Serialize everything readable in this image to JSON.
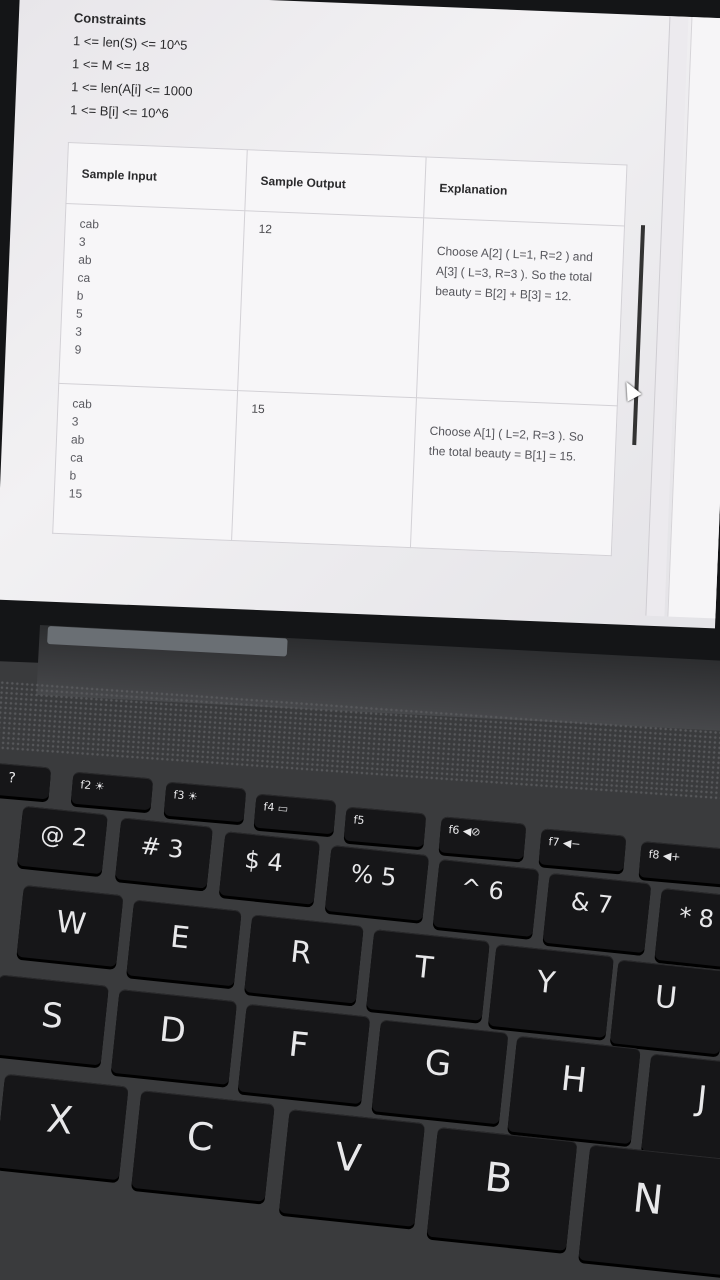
{
  "constraints": {
    "heading": "Constraints",
    "lines": [
      "1 <= len(S) <= 10^5",
      "1 <= M <= 18",
      "1 <= len(A[i] <= 1000",
      "1 <= B[i] <= 10^6"
    ]
  },
  "table": {
    "headers": [
      "Sample Input",
      "Sample Output",
      "Explanation"
    ],
    "rows": [
      {
        "input": [
          "cab",
          "3",
          "ab",
          "ca",
          "b",
          "5",
          "3",
          "9"
        ],
        "output": "12",
        "explanation": "Choose A[2] ( L=1, R=2 ) and A[3] ( L=3, R=3 ). So the total beauty = B[2] + B[3] = 12."
      },
      {
        "input": [
          "cab",
          "3",
          "ab",
          "ca",
          "b",
          "15"
        ],
        "output": "15",
        "explanation": "Choose A[1] ( L=2, R=3 ). So the total beauty = B[1] = 15."
      }
    ]
  },
  "keyboard": {
    "fn_row": [
      "?",
      "f2 ☀",
      "f3 ☀",
      "f4 ▭",
      "f5",
      "f6 ◀⊘",
      "f7 ◀−",
      "f8 ◀+"
    ],
    "number_row": [
      "@ 2",
      "# 3",
      "$ 4",
      "% 5",
      "^ 6",
      "& 7",
      "* 8"
    ],
    "qwerty_row": [
      "W",
      "E",
      "R",
      "T",
      "Y",
      "U"
    ],
    "home_row": [
      "S",
      "D",
      "F",
      "G",
      "H",
      "J"
    ],
    "bottom_row": [
      "X",
      "C",
      "V",
      "B",
      "N"
    ]
  }
}
